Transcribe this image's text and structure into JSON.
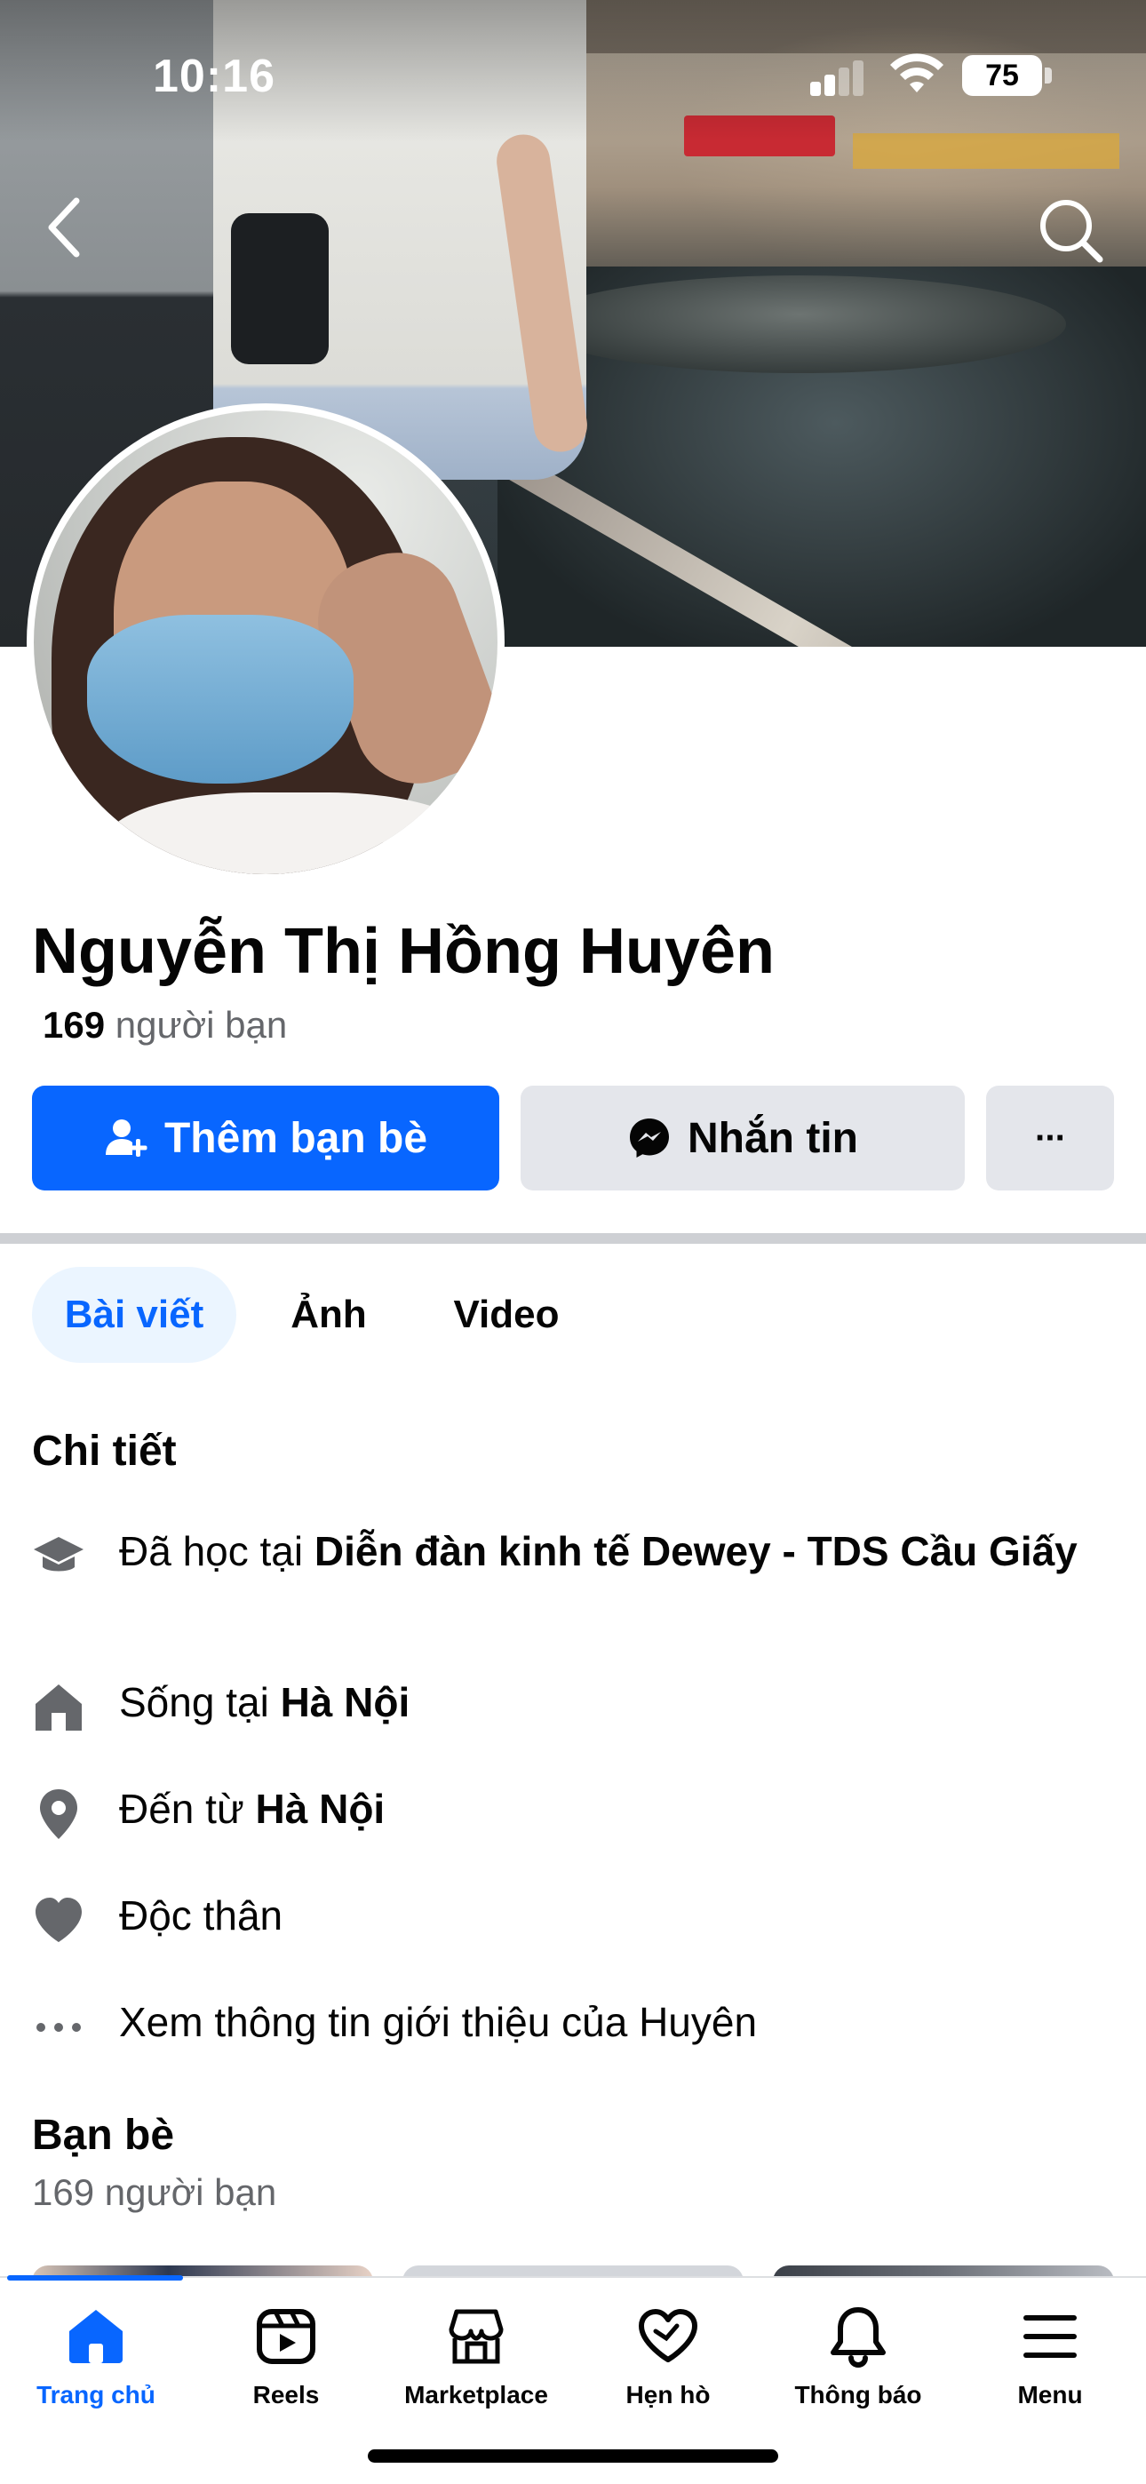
{
  "status_bar": {
    "time": "10:16",
    "battery": "75"
  },
  "profile": {
    "name": "Nguyễn Thị Hồng Huyên",
    "friends_count": "169",
    "friends_label": "người bạn"
  },
  "actions": {
    "add_friend": "Thêm bạn bè",
    "message": "Nhắn tin",
    "more": "···"
  },
  "tabs": [
    {
      "label": "Bài viết",
      "active": true
    },
    {
      "label": "Ảnh",
      "active": false
    },
    {
      "label": "Video",
      "active": false
    }
  ],
  "details": {
    "title": "Chi tiết",
    "items": [
      {
        "icon": "graduation-cap-icon",
        "prefix": "Đã học tại ",
        "value": "Diễn đàn kinh tế Dewey - TDS Cầu Giấy"
      },
      {
        "icon": "home-icon",
        "prefix": "Sống tại ",
        "value": "Hà Nội"
      },
      {
        "icon": "location-pin-icon",
        "prefix": "Đến từ ",
        "value": "Hà Nội"
      },
      {
        "icon": "heart-icon",
        "prefix": "Độc thân",
        "value": ""
      },
      {
        "icon": "more-dots-icon",
        "prefix": "Xem thông tin giới thiệu của Huyên",
        "value": ""
      }
    ]
  },
  "friends_section": {
    "title": "Bạn bè",
    "count_text": "169 người bạn"
  },
  "bottom_nav": [
    {
      "label": "Trang chủ",
      "icon": "home-icon",
      "active": true
    },
    {
      "label": "Reels",
      "icon": "reels-icon",
      "active": false
    },
    {
      "label": "Marketplace",
      "icon": "marketplace-icon",
      "active": false
    },
    {
      "label": "Hẹn hò",
      "icon": "dating-heart-icon",
      "active": false
    },
    {
      "label": "Thông báo",
      "icon": "bell-icon",
      "active": false
    },
    {
      "label": "Menu",
      "icon": "menu-icon",
      "active": false
    }
  ],
  "colors": {
    "primary": "#0866ff",
    "secondary_button": "#e4e6eb",
    "text_primary": "#050505",
    "text_secondary": "#65676b",
    "active_tab_bg": "#ebf5ff"
  }
}
